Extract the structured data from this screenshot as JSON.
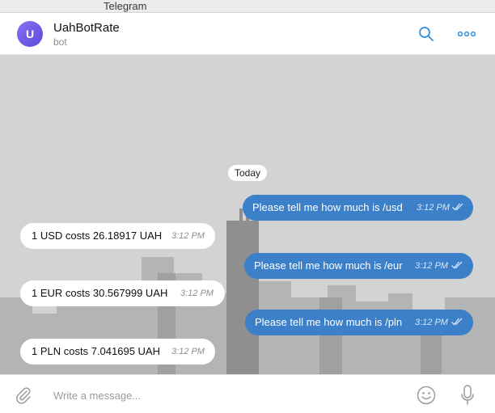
{
  "window": {
    "title": "Telegram"
  },
  "header": {
    "avatar_letter": "U",
    "chat_name": "UahBotRate",
    "chat_status": "bot",
    "search_icon": "search-icon",
    "more_icon": "more-icon"
  },
  "chat": {
    "date_separator": "Today",
    "messages": [
      {
        "direction": "out",
        "text": "Please tell me how much is /usd",
        "time": "3:12 PM",
        "read": true
      },
      {
        "direction": "in",
        "text": "1 USD costs 26.18917 UAH",
        "time": "3:12 PM"
      },
      {
        "direction": "out",
        "text": "Please tell me how much is /eur",
        "time": "3:12 PM",
        "read": true
      },
      {
        "direction": "in",
        "text": "1 EUR costs 30.567999 UAH",
        "time": "3:12 PM"
      },
      {
        "direction": "out",
        "text": "Please tell me how much is /pln",
        "time": "3:12 PM",
        "read": true
      },
      {
        "direction": "in",
        "text": "1 PLN costs 7.041695 UAH",
        "time": "3:12 PM"
      }
    ]
  },
  "composer": {
    "placeholder": "Write a message...",
    "value": ""
  },
  "colors": {
    "accent": "#3c80c9",
    "avatar_gradient_start": "#8a6ff5",
    "avatar_gradient_end": "#5a4ad9",
    "incoming_bubble": "#ffffff",
    "icon_blue": "#2f8fde"
  }
}
